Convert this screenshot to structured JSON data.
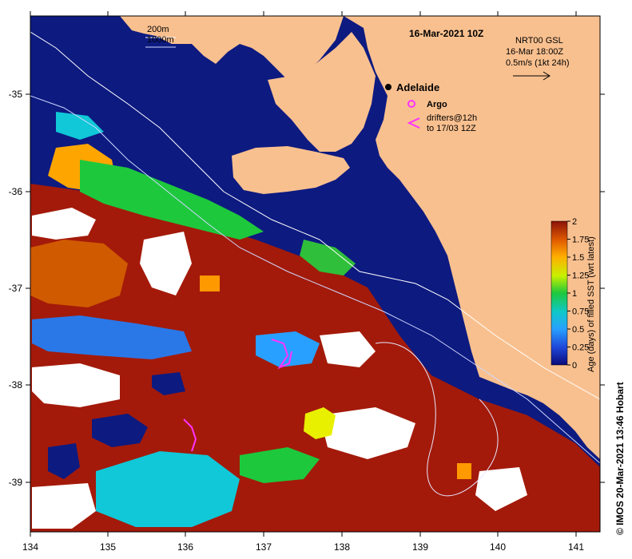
{
  "map": {
    "title": "16-Mar-2021 10Z",
    "depth_labels": [
      "200m",
      "1000m"
    ],
    "current_info": {
      "line1": "NRT00 GSL",
      "line2": "16-Mar 18:00Z",
      "line3": "0.5m/s (1kt 24h)"
    },
    "place": "Adelaide",
    "legend": {
      "argo": "Argo",
      "drifters_line1": "drifters@12h",
      "drifters_line2": "to 17/03 12Z"
    },
    "x_ticks": [
      "134",
      "135",
      "136",
      "137",
      "138",
      "139",
      "140",
      "141"
    ],
    "y_ticks": [
      "-35",
      "-36",
      "-37",
      "-38",
      "-39"
    ],
    "colorbar": {
      "title": "Age (days) of filled SST (wrt latest)",
      "ticks": [
        "2",
        "1.75",
        "1.5",
        "1.25",
        "1",
        "0.75",
        "0.5",
        "0.25",
        "0"
      ]
    },
    "credit": "© IMOS 20-Mar-2021 13:46 Hobart",
    "colors": {
      "ocean": "#0d1a80",
      "land": "#f9c08f",
      "old_sst": "#a31a0a",
      "argo": "#ff33ff"
    }
  }
}
